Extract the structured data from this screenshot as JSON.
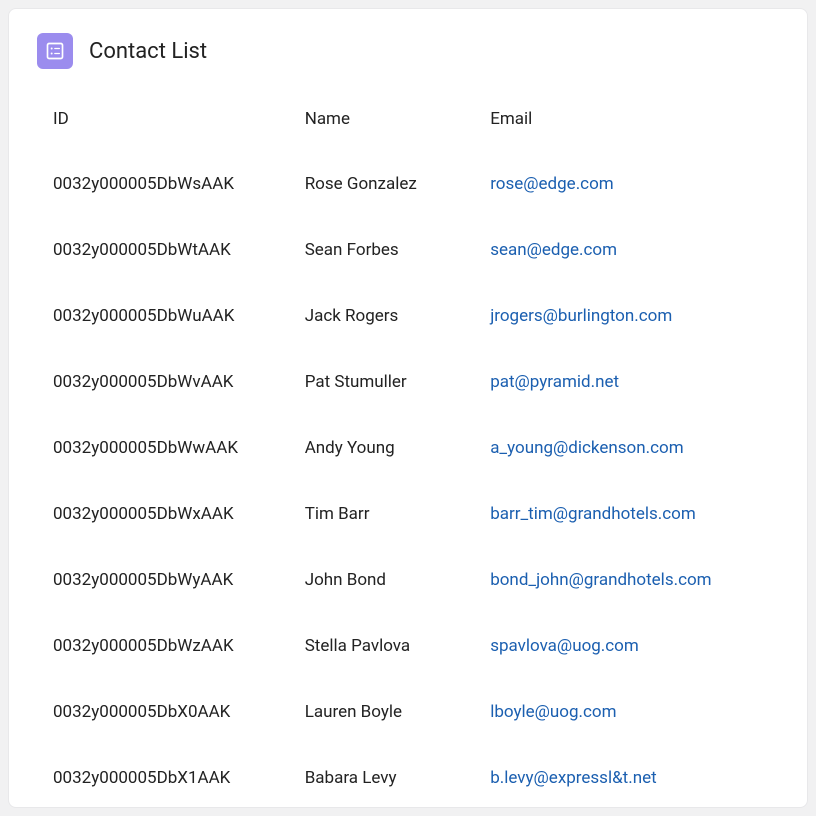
{
  "header": {
    "title": "Contact List"
  },
  "table": {
    "columns": {
      "id": "ID",
      "name": "Name",
      "email": "Email"
    },
    "rows": [
      {
        "id": "0032y000005DbWsAAK",
        "name": "Rose Gonzalez",
        "email": "rose@edge.com"
      },
      {
        "id": "0032y000005DbWtAAK",
        "name": "Sean Forbes",
        "email": "sean@edge.com"
      },
      {
        "id": "0032y000005DbWuAAK",
        "name": "Jack Rogers",
        "email": "jrogers@burlington.com"
      },
      {
        "id": "0032y000005DbWvAAK",
        "name": "Pat Stumuller",
        "email": "pat@pyramid.net"
      },
      {
        "id": "0032y000005DbWwAAK",
        "name": "Andy Young",
        "email": "a_young@dickenson.com"
      },
      {
        "id": "0032y000005DbWxAAK",
        "name": "Tim Barr",
        "email": "barr_tim@grandhotels.com"
      },
      {
        "id": "0032y000005DbWyAAK",
        "name": "John Bond",
        "email": "bond_john@grandhotels.com"
      },
      {
        "id": "0032y000005DbWzAAK",
        "name": "Stella Pavlova",
        "email": "spavlova@uog.com"
      },
      {
        "id": "0032y000005DbX0AAK",
        "name": "Lauren Boyle",
        "email": "lboyle@uog.com"
      },
      {
        "id": "0032y000005DbX1AAK",
        "name": "Babara Levy",
        "email": "b.levy@expressl&t.net"
      }
    ]
  }
}
